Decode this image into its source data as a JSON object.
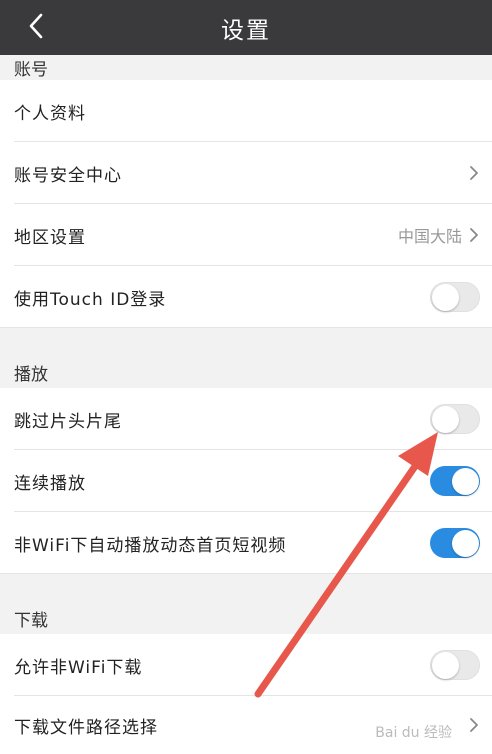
{
  "header": {
    "title": "设置"
  },
  "sections": {
    "account": {
      "title": "账号"
    },
    "playback": {
      "title": "播放"
    },
    "download": {
      "title": "下载"
    }
  },
  "rows": {
    "profile": {
      "label": "个人资料"
    },
    "security": {
      "label": "账号安全中心"
    },
    "region": {
      "label": "地区设置",
      "value": "中国大陆"
    },
    "touch_id": {
      "label": "使用Touch ID登录",
      "enabled": false
    },
    "skip_intro": {
      "label": "跳过片头片尾",
      "enabled": false
    },
    "autoplay_next": {
      "label": "连续播放",
      "enabled": true
    },
    "non_wifi_autoplay": {
      "label": "非WiFi下自动播放动态首页短视频",
      "enabled": true
    },
    "non_wifi_download": {
      "label": "允许非WiFi下载",
      "enabled": false
    },
    "download_path": {
      "label": "下载文件路径选择"
    }
  },
  "colors": {
    "header_bg": "#3a3a3c",
    "toggle_on": "#2a8ce0",
    "annotation_arrow": "#e8574b"
  },
  "watermark": {
    "text": "Bai du 经验"
  }
}
